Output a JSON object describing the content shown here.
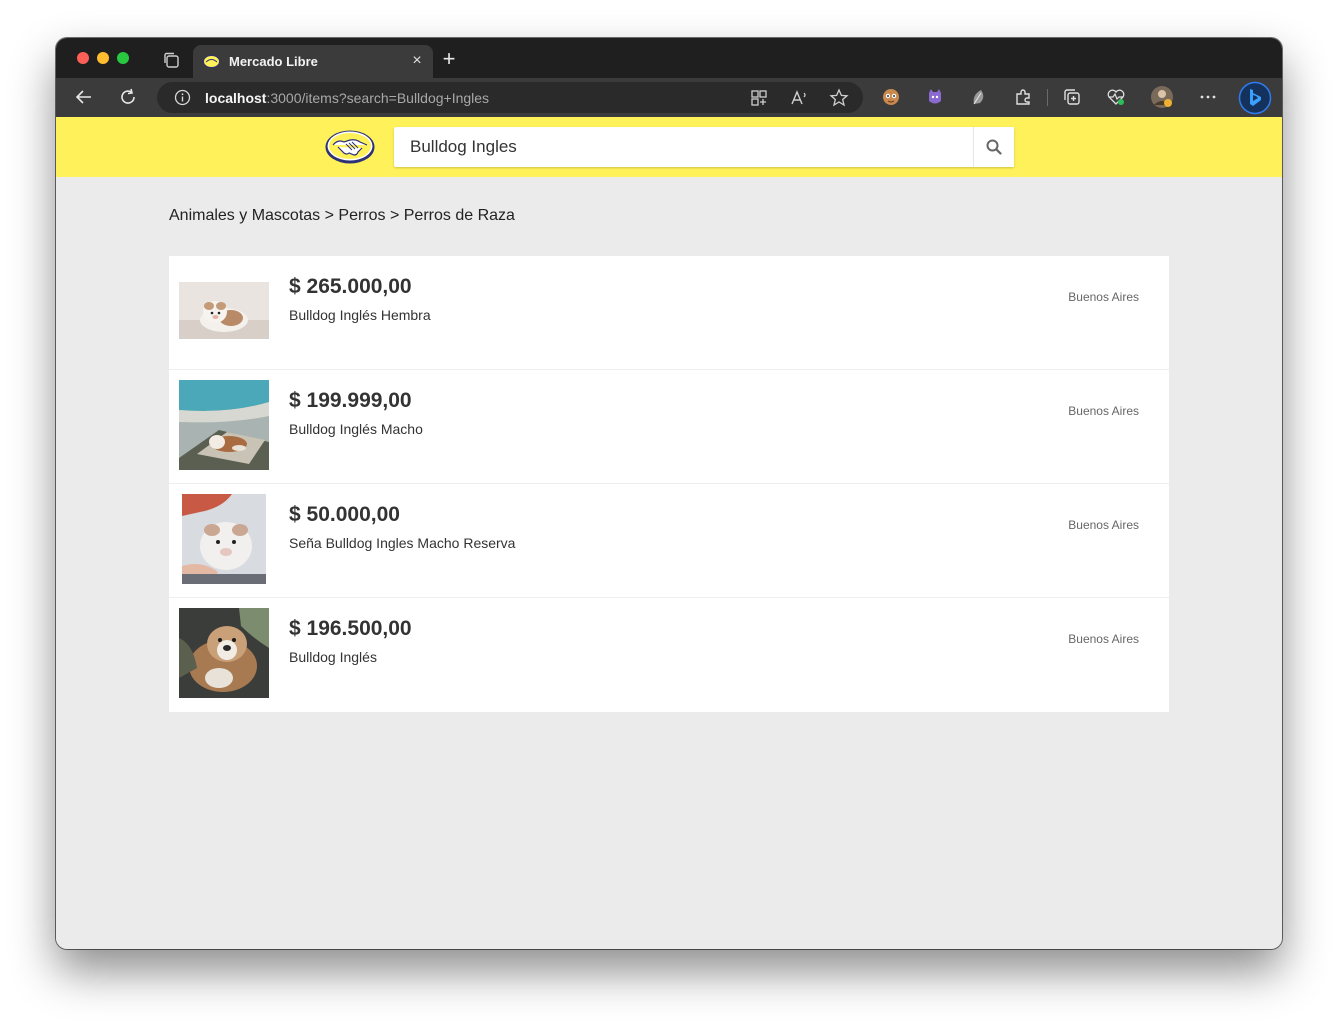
{
  "browser": {
    "tab": {
      "title": "Mercado Libre"
    },
    "address": {
      "host": "localhost",
      "path": ":3000/items?search=Bulldog+Ingles"
    },
    "icons": {
      "tab_actions": "tab-collection-icon",
      "back": "back-arrow-icon",
      "reload": "reload-icon",
      "info": "info-icon",
      "apps": "apps-icon",
      "read_aloud": "read-aloud-icon",
      "favorite": "star-icon",
      "extensions": [
        "extension-face-icon",
        "extension-cat-icon",
        "extension-leaf-icon",
        "extensions-puzzle-icon",
        "collections-icon",
        "performance-icon",
        "profile-avatar-icon",
        "more-icon",
        "bing-icon"
      ]
    }
  },
  "site": {
    "header_color": "#fff159",
    "search": {
      "value": "Bulldog Ingles"
    }
  },
  "breadcrumb": "Animales y Mascotas > Perros > Perros de Raza",
  "results": [
    {
      "price": "$ 265.000,00",
      "title": "Bulldog Inglés Hembra",
      "location": "Buenos Aires"
    },
    {
      "price": "$ 199.999,00",
      "title": "Bulldog Inglés Macho",
      "location": "Buenos Aires"
    },
    {
      "price": "$ 50.000,00",
      "title": "Seña Bulldog Ingles Macho Reserva",
      "location": "Buenos Aires"
    },
    {
      "price": "$ 196.500,00",
      "title": "Bulldog Inglés",
      "location": "Buenos Aires"
    }
  ]
}
